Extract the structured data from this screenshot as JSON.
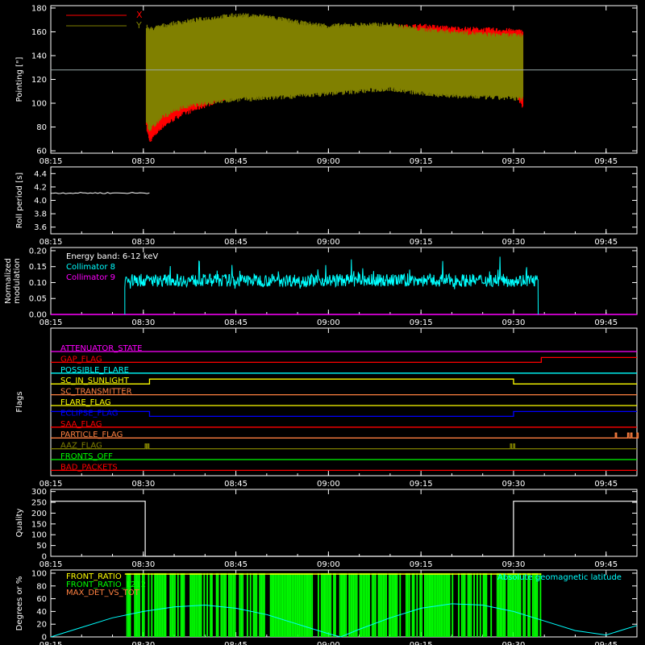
{
  "chart_data": [
    {
      "type": "line",
      "id": "pointing",
      "ylabel": "Pointing [\"]",
      "ylim": [
        58,
        182
      ],
      "yticks": [
        60,
        80,
        100,
        120,
        140,
        160,
        180
      ],
      "xlim_min": [
        15,
        110
      ],
      "xticks": [
        {
          "min": 15,
          "label": "08:15"
        },
        {
          "min": 30,
          "label": "08:30"
        },
        {
          "min": 45,
          "label": "08:45"
        },
        {
          "min": 60,
          "label": "09:00"
        },
        {
          "min": 75,
          "label": "09:15"
        },
        {
          "min": 90,
          "label": "09:30"
        },
        {
          "min": 105,
          "label": "09:45"
        }
      ],
      "reference_line": 128,
      "series": [
        {
          "name": "X",
          "color": "#ff0000",
          "x": [
            30.5,
            31,
            33,
            36,
            40,
            45,
            50,
            55,
            60,
            65,
            70,
            75,
            80,
            85,
            90,
            91.5
          ],
          "high": [
            160,
            158,
            160,
            162,
            165,
            170,
            168,
            163,
            158,
            160,
            164,
            165,
            163,
            162,
            161,
            160
          ],
          "low": [
            80,
            68,
            80,
            90,
            98,
            108,
            116,
            122,
            125,
            127,
            126,
            122,
            118,
            114,
            110,
            97
          ]
        },
        {
          "name": "Y",
          "color": "#808000",
          "x": [
            30.5,
            31,
            33,
            36,
            40,
            45,
            50,
            55,
            60,
            65,
            70,
            75,
            80,
            85,
            90,
            91.5
          ],
          "high": [
            165,
            162,
            165,
            168,
            171,
            174,
            173,
            168,
            165,
            166,
            166,
            162,
            160,
            158,
            157,
            157
          ],
          "low": [
            85,
            77,
            88,
            96,
            100,
            103,
            104,
            106,
            108,
            110,
            112,
            108,
            106,
            105,
            104,
            104
          ]
        }
      ]
    },
    {
      "type": "line",
      "id": "roll",
      "ylabel": "Roll period [s]",
      "ylim": [
        3.5,
        4.5
      ],
      "yticks": [
        3.6,
        3.8,
        4.0,
        4.2,
        4.4
      ],
      "series": [
        {
          "name": "",
          "color": "#ffffff",
          "x": [
            15,
            31
          ],
          "y": [
            4.11,
            4.11
          ]
        }
      ]
    },
    {
      "type": "line",
      "id": "modulation",
      "ylabel": "Normalized modulation",
      "ylim": [
        0,
        0.21
      ],
      "yticks": [
        0.0,
        0.05,
        0.1,
        0.15,
        0.2
      ],
      "annotation": "Energy band: 6-12 keV",
      "series": [
        {
          "name": "Collimator 8",
          "color": "#00ffff",
          "x_range": [
            27,
            94
          ],
          "mean": 0.107,
          "spread": 0.02
        },
        {
          "name": "Collimator 9",
          "color": "#ff00ff",
          "x_range": [
            15,
            110
          ],
          "value": 0.0
        }
      ]
    },
    {
      "type": "line",
      "id": "flags",
      "ylabel": "Flags",
      "flags": [
        {
          "label": "ATTENUATOR_STATE",
          "color": "#ff00ff",
          "steps": []
        },
        {
          "label": "GAP_FLAG",
          "color": "#ff0000",
          "steps": [
            [
              15,
              0
            ],
            [
              94.5,
              1
            ]
          ]
        },
        {
          "label": "POSSIBLE_FLARE",
          "color": "#00ffff",
          "steps": []
        },
        {
          "label": "SC_IN_SUNLIGHT",
          "color": "#ffff00",
          "steps": [
            [
              15,
              0
            ],
            [
              31,
              1
            ],
            [
              90,
              0
            ]
          ]
        },
        {
          "label": "SC_TRANSMITTER",
          "color": "#ff8040",
          "steps": []
        },
        {
          "label": "FLARE_FLAG",
          "color": "#ffff00",
          "steps": []
        },
        {
          "label": "ECLIPSE_FLAG",
          "color": "#0000ff",
          "steps": [
            [
              15,
              1
            ],
            [
              31,
              0
            ],
            [
              90,
              1
            ]
          ]
        },
        {
          "label": "SAA_FLAG",
          "color": "#ff0000",
          "steps": []
        },
        {
          "label": "PARTICLE_FLAG",
          "color": "#ff8040",
          "spikes": [
            106.5,
            108.5,
            109,
            110
          ]
        },
        {
          "label": "AAZ_FLAG",
          "color": "#808000",
          "spikes": [
            30.3,
            30.7,
            89.5,
            90
          ]
        },
        {
          "label": "FRONTS_OFF",
          "color": "#00ff00",
          "steps": []
        },
        {
          "label": "BAD_PACKETS",
          "color": "#ff0000",
          "steps": []
        }
      ]
    },
    {
      "type": "line",
      "id": "quality",
      "ylabel": "Quality",
      "ylim": [
        0,
        310
      ],
      "yticks": [
        0,
        50,
        100,
        150,
        200,
        250,
        300
      ],
      "series": [
        {
          "name": "",
          "color": "#ffffff",
          "x": [
            15,
            30.3,
            30.3,
            90,
            90,
            110
          ],
          "y": [
            255,
            255,
            0,
            0,
            255,
            255
          ]
        }
      ]
    },
    {
      "type": "line",
      "id": "geomag",
      "ylabel": "Degrees or %",
      "ylim": [
        0,
        105
      ],
      "yticks": [
        0,
        20,
        40,
        60,
        80,
        100
      ],
      "legend": [
        {
          "name": "FRONT_RATIO",
          "color": "#ffff00"
        },
        {
          "name": "FRONT_RATIO_1212",
          "color": "#00ff00"
        },
        {
          "name": "MAX_DET_VS_TOT",
          "color": "#ff8040"
        }
      ],
      "annotation": "Absolute geomagnetic latitude",
      "annotation_color": "#00ffff",
      "latitude": {
        "color": "#00ffff",
        "x": [
          15,
          20,
          25,
          30,
          35,
          40,
          45,
          50,
          55,
          60,
          62,
          65,
          70,
          75,
          80,
          85,
          90,
          95,
          100,
          105,
          108,
          110
        ],
        "y": [
          0,
          15,
          30,
          40,
          47,
          50,
          45,
          35,
          20,
          5,
          0,
          12,
          30,
          45,
          52,
          50,
          40,
          25,
          10,
          3,
          12,
          18
        ]
      },
      "front_ratio_1212": {
        "color": "#00ff00",
        "x_range": [
          27,
          94.5
        ],
        "value": 100
      }
    }
  ]
}
